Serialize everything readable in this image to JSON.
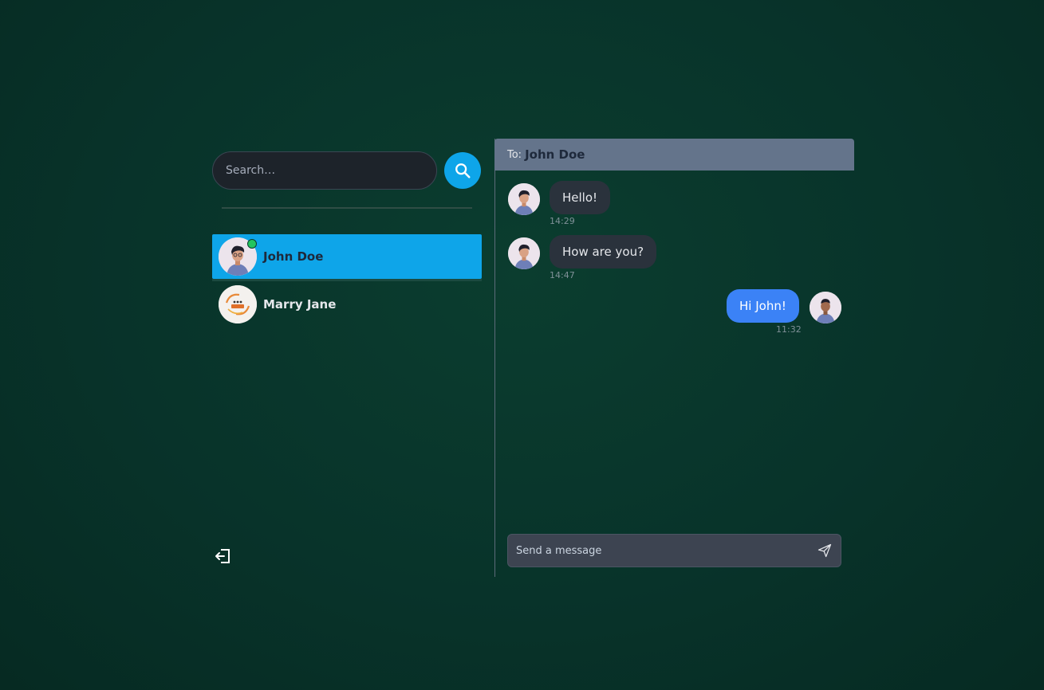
{
  "sidebar": {
    "search": {
      "placeholder": "Search…"
    },
    "contacts": [
      {
        "name": "John Doe",
        "active": true,
        "online": true,
        "avatar": "person-avatar"
      },
      {
        "name": "Marry Jane",
        "active": false,
        "online": false,
        "avatar": "logo-avatar"
      }
    ],
    "logout_icon": "logout-icon"
  },
  "chat": {
    "header": {
      "to_label": "To:",
      "recipient": "John Doe"
    },
    "messages": [
      {
        "text": "Hello!",
        "time": "14:29",
        "direction": "in"
      },
      {
        "text": "How are you?",
        "time": "14:47",
        "direction": "in"
      },
      {
        "text": "Hi John!",
        "time": "11:32",
        "direction": "out"
      }
    ],
    "composer": {
      "placeholder": "Send a message"
    }
  },
  "colors": {
    "accent": "#0ea5e9",
    "outgoing_bubble": "#3b82f6",
    "incoming_bubble": "#2a323c",
    "header": "#64748b",
    "online": "#22c55e"
  }
}
